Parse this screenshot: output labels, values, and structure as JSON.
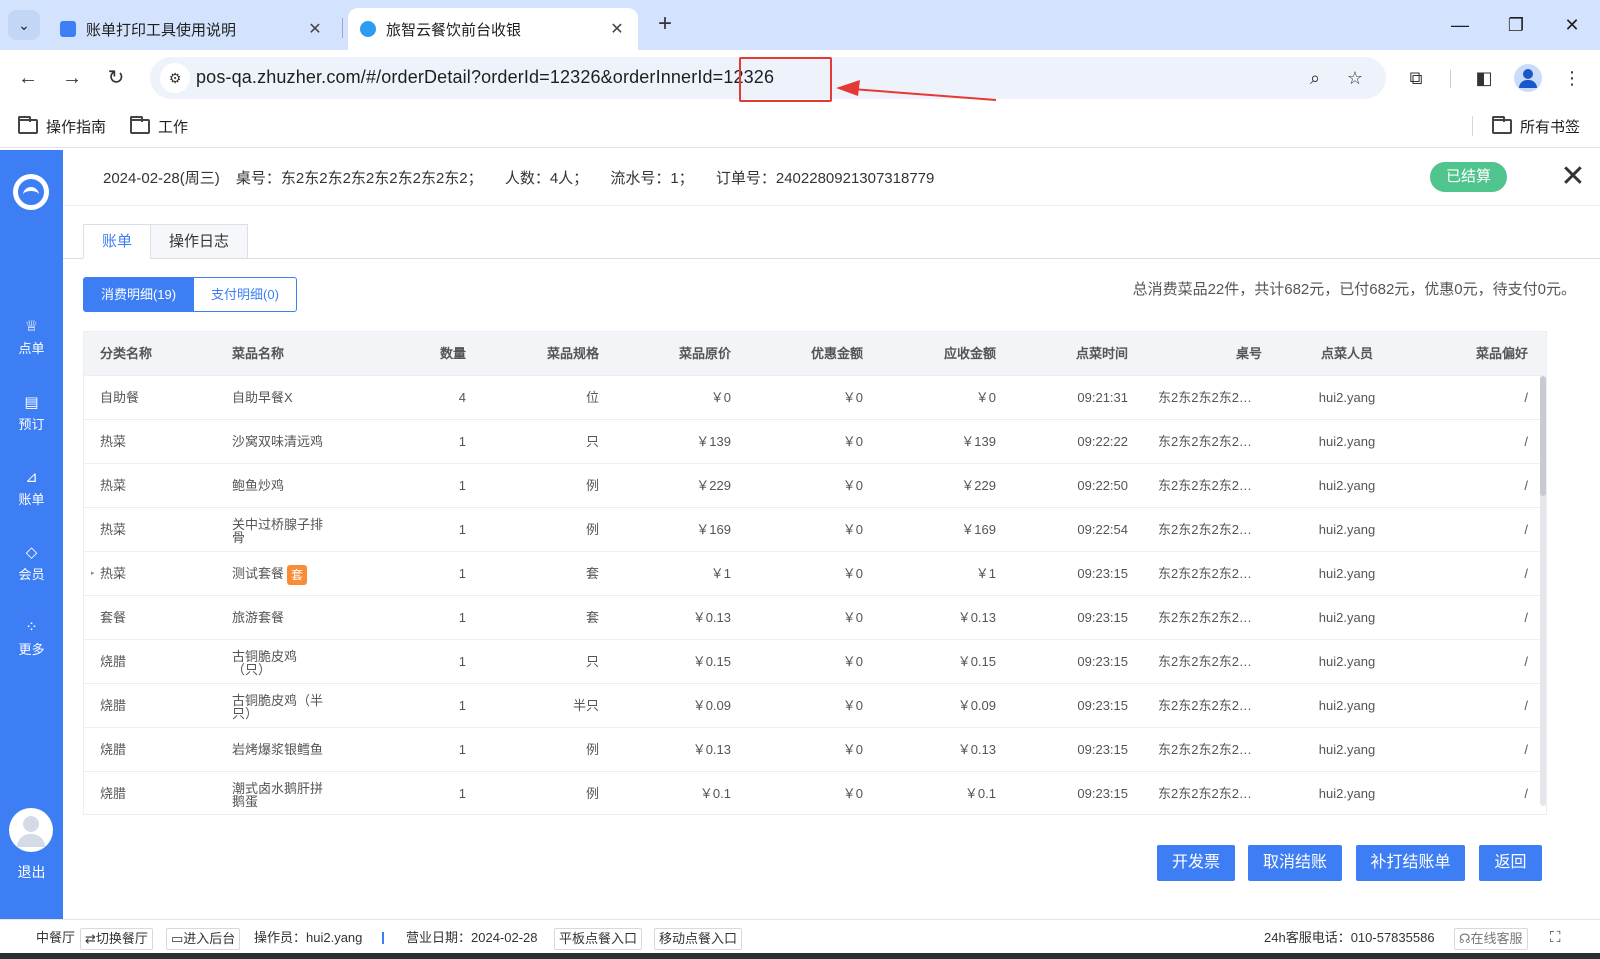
{
  "browser": {
    "tabs": [
      {
        "title": "账单打印工具使用说明",
        "favicon_color": "#3d7ef5",
        "active": false
      },
      {
        "title": "旅智云餐饮前台收银",
        "favicon_color": "#2d9cf0",
        "active": true
      }
    ],
    "url": "pos-qa.zhuzher.com/#/orderDetail?orderId=12326&orderInnerId=12326",
    "bookmarks": [
      "操作指南",
      "工作"
    ],
    "all_bookmarks": "所有书签"
  },
  "sidebar": {
    "items": [
      {
        "label": "点单",
        "icon": "chef-hat-icon"
      },
      {
        "label": "预订",
        "icon": "book-icon"
      },
      {
        "label": "账单",
        "icon": "chart-icon"
      },
      {
        "label": "会员",
        "icon": "diamond-icon"
      },
      {
        "label": "更多",
        "icon": "grid-icon"
      }
    ],
    "logout": "退出"
  },
  "order": {
    "date": "2024-02-28(周三)",
    "table": "桌号：东2东2东2东2东2东2东2东2；",
    "guests": "人数：4人；",
    "serial": "流水号：1；",
    "order_no": "订单号：2402280921307318779",
    "status": "已结算"
  },
  "tabs": [
    "账单",
    "操作日志"
  ],
  "segments": [
    "消费明细(19)",
    "支付明细(0)"
  ],
  "summary": "总消费菜品22件，共计682元，已付682元，优惠0元，待支付0元。",
  "table": {
    "headers": [
      "分类名称",
      "菜品名称",
      "数量",
      "菜品规格",
      "菜品原价",
      "优惠金额",
      "应收金额",
      "点菜时间",
      "桌号",
      "点菜人员",
      "菜品偏好"
    ],
    "rows": [
      {
        "category": "自助餐",
        "dish": "自助早餐X",
        "qty": "4",
        "spec": "位",
        "price": "￥0",
        "discount": "￥0",
        "due": "￥0",
        "time": "09:21:31",
        "table": "东2东2东2东2…",
        "staff": "hui2.yang",
        "pref": "/"
      },
      {
        "category": "热菜",
        "dish": "沙窝双味清远鸡",
        "qty": "1",
        "spec": "只",
        "price": "￥139",
        "discount": "￥0",
        "due": "￥139",
        "time": "09:22:22",
        "table": "东2东2东2东2…",
        "staff": "hui2.yang",
        "pref": "/"
      },
      {
        "category": "热菜",
        "dish": "鲍鱼炒鸡",
        "qty": "1",
        "spec": "例",
        "price": "￥229",
        "discount": "￥0",
        "due": "￥229",
        "time": "09:22:50",
        "table": "东2东2东2东2…",
        "staff": "hui2.yang",
        "pref": "/"
      },
      {
        "category": "热菜",
        "dish": "关中过桥腺子排骨",
        "qty": "1",
        "spec": "例",
        "price": "￥169",
        "discount": "￥0",
        "due": "￥169",
        "time": "09:22:54",
        "table": "东2东2东2东2…",
        "staff": "hui2.yang",
        "pref": "/"
      },
      {
        "category": "热菜",
        "dish": "测试套餐",
        "combo_tag": "套",
        "qty": "1",
        "spec": "套",
        "price": "￥1",
        "discount": "￥0",
        "due": "￥1",
        "time": "09:23:15",
        "table": "东2东2东2东2…",
        "staff": "hui2.yang",
        "pref": "/"
      },
      {
        "category": "套餐",
        "dish": "旅游套餐",
        "qty": "1",
        "spec": "套",
        "price": "￥0.13",
        "discount": "￥0",
        "due": "￥0.13",
        "time": "09:23:15",
        "table": "东2东2东2东2…",
        "staff": "hui2.yang",
        "pref": "/"
      },
      {
        "category": "烧腊",
        "dish": "古铜脆皮鸡（只）",
        "qty": "1",
        "spec": "只",
        "price": "￥0.15",
        "discount": "￥0",
        "due": "￥0.15",
        "time": "09:23:15",
        "table": "东2东2东2东2…",
        "staff": "hui2.yang",
        "pref": "/"
      },
      {
        "category": "烧腊",
        "dish": "古铜脆皮鸡（半只）",
        "qty": "1",
        "spec": "半只",
        "price": "￥0.09",
        "discount": "￥0",
        "due": "￥0.09",
        "time": "09:23:15",
        "table": "东2东2东2东2…",
        "staff": "hui2.yang",
        "pref": "/"
      },
      {
        "category": "烧腊",
        "dish": "岩烤爆浆银鳕鱼",
        "qty": "1",
        "spec": "例",
        "price": "￥0.13",
        "discount": "￥0",
        "due": "￥0.13",
        "time": "09:23:15",
        "table": "东2东2东2东2…",
        "staff": "hui2.yang",
        "pref": "/"
      },
      {
        "category": "烧腊",
        "dish": "潮式卤水鹅肝拼鹅蛋",
        "qty": "1",
        "spec": "例",
        "price": "￥0.1",
        "discount": "￥0",
        "due": "￥0.1",
        "time": "09:23:15",
        "table": "东2东2东2东2…",
        "staff": "hui2.yang",
        "pref": "/"
      }
    ]
  },
  "actions": [
    "开发票",
    "取消结账",
    "补打结账单",
    "返回"
  ],
  "statusbar": {
    "restaurant": "中餐厅",
    "switch": "切换餐厅",
    "backend": "进入后台",
    "operator": "操作员：hui2.yang",
    "business_date": "营业日期：2024-02-28",
    "tablet": "平板点餐入口",
    "mobile": "移动点餐入口",
    "hotline": "24h客服电话：010-57835586",
    "online": "在线客服"
  },
  "colors": {
    "primary": "#3d7ef5",
    "settled": "#4fc48c",
    "combo_tag": "#fa8c35",
    "annotation": "#e53935"
  }
}
